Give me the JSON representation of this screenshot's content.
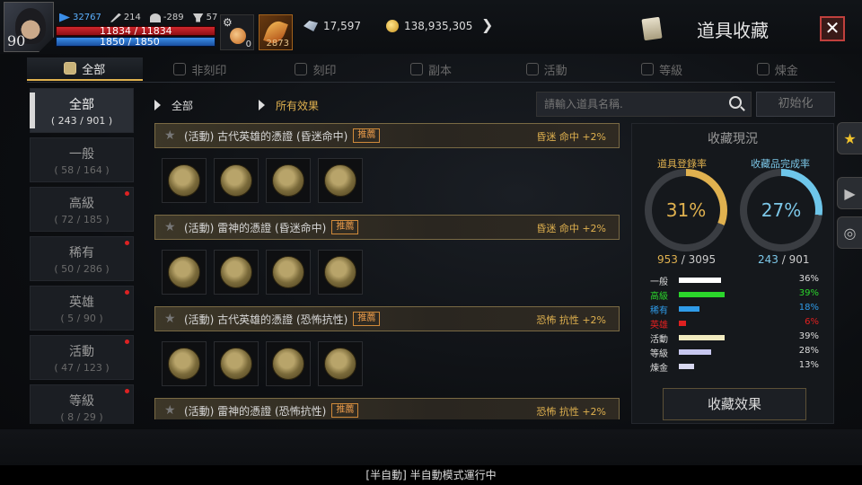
{
  "player": {
    "level": "90",
    "stat1": "32767",
    "stat2": "214",
    "stat3": "-289",
    "stat4": "57",
    "hp": "11834 / 11834",
    "mp": "1850 / 1850"
  },
  "items_top": {
    "potion_count": "0",
    "feather_count": "2873"
  },
  "currency": {
    "crystal": "17,597",
    "gold": "138,935,305"
  },
  "window": {
    "title": "道具收藏",
    "close": "✕"
  },
  "tabs": [
    {
      "label": "全部",
      "active": true
    },
    {
      "label": "非刻印"
    },
    {
      "label": "刻印"
    },
    {
      "label": "副本"
    },
    {
      "label": "活動"
    },
    {
      "label": "等級"
    },
    {
      "label": "煉金"
    }
  ],
  "sidebar": [
    {
      "name": "全部",
      "count": "( 243 / 901 )",
      "active": true
    },
    {
      "name": "一般",
      "count": "( 58 / 164 )"
    },
    {
      "name": "高級",
      "count": "( 72 / 185 )",
      "dot": true
    },
    {
      "name": "稀有",
      "count": "( 50 / 286 )",
      "dot": true
    },
    {
      "name": "英雄",
      "count": "( 5 / 90 )",
      "dot": true
    },
    {
      "name": "活動",
      "count": "( 47 / 123 )",
      "dot": true
    },
    {
      "name": "等級",
      "count": "( 8 / 29 )",
      "dot": true
    }
  ],
  "filter": {
    "category": "全部",
    "effect": "所有效果"
  },
  "search": {
    "placeholder": "請輸入道具名稱."
  },
  "reset_label": "初始化",
  "entries": [
    {
      "name": "(活動) 古代英雄的憑證 (昏迷命中)",
      "tag": "推薦",
      "effect": "昏迷 命中 +2%"
    },
    {
      "name": "(活動) 雷神的憑證 (昏迷命中)",
      "tag": "推薦",
      "effect": "昏迷 命中 +2%"
    },
    {
      "name": "(活動) 古代英雄的憑證 (恐怖抗性)",
      "tag": "推薦",
      "effect": "恐怖 抗性 +2%"
    },
    {
      "name": "(活動) 雷神的憑證 (恐怖抗性)",
      "tag": "推薦",
      "effect": "恐怖 抗性 +2%"
    }
  ],
  "panel": {
    "title": "收藏現況",
    "reg_label": "道具登錄率",
    "comp_label": "收藏品完成率",
    "reg_pct": "31%",
    "comp_pct": "27%",
    "reg_have": "953",
    "reg_total": " / 3095",
    "comp_have": "243",
    "comp_total": " / 901",
    "bars": [
      {
        "label": "一般",
        "pct": "36%",
        "value": 36,
        "color": "#ffffff",
        "label_color": "#dddddd"
      },
      {
        "label": "高級",
        "pct": "39%",
        "value": 39,
        "color": "#2bd62b",
        "label_color": "#2bd62b"
      },
      {
        "label": "稀有",
        "pct": "18%",
        "value": 18,
        "color": "#2f9be8",
        "label_color": "#2f9be8"
      },
      {
        "label": "英雄",
        "pct": "6%",
        "value": 6,
        "color": "#e02020",
        "label_color": "#e02020"
      },
      {
        "label": "活動",
        "pct": "39%",
        "value": 39,
        "color": "#f2ebc0",
        "label_color": "#dddddd"
      },
      {
        "label": "等級",
        "pct": "28%",
        "value": 28,
        "color": "#c8c8f0",
        "label_color": "#dddddd"
      },
      {
        "label": "煉金",
        "pct": "13%",
        "value": 13,
        "color": "#d8d8f0",
        "label_color": "#dddddd"
      }
    ],
    "collect_label": "收藏效果"
  },
  "status_text": "[半自動] 半自動模式運行中"
}
